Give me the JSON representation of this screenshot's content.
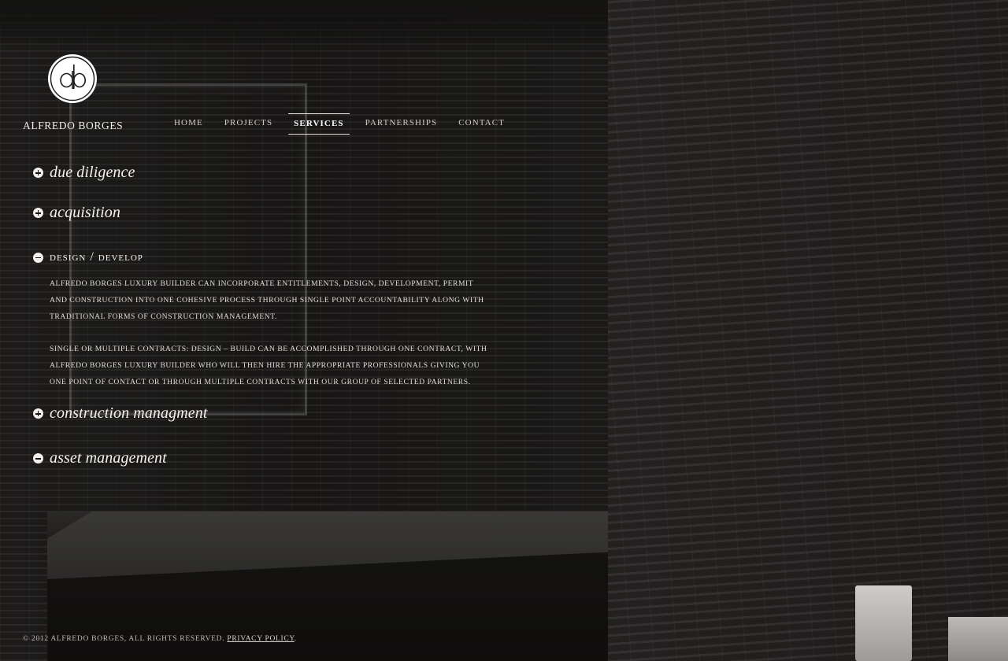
{
  "brand": {
    "name": "ALFREDO BORGES",
    "monogram": "ab"
  },
  "nav": {
    "items": [
      {
        "label": "HOME",
        "active": false
      },
      {
        "label": "PROJECTS",
        "active": false
      },
      {
        "label": "SERVICES",
        "active": true
      },
      {
        "label": "PARTNERSHIPS",
        "active": false
      },
      {
        "label": "CONTACT",
        "active": false
      }
    ]
  },
  "services": {
    "items": [
      {
        "title": "due diligence",
        "expanded": false,
        "icon": "plus-circle-icon"
      },
      {
        "title": "acquisition",
        "expanded": false,
        "icon": "plus-circle-icon"
      },
      {
        "title": "design / develop",
        "expanded": true,
        "icon": "minus-circle-icon",
        "paragraphs": [
          "Alfredo Borges Luxury Builder can incorporate entitlements, design, development, permit and construction into one cohesive process through single point accountability along with traditional forms of construction management.",
          "Single or multiple contracts: Design – Build can be accomplished through one contract, with Alfredo Borges Luxury Builder who will then hire the appropriate professionals giving you one point of contact or through multiple contracts with our group of selected partners."
        ]
      },
      {
        "title": "construction managment",
        "expanded": false,
        "icon": "plus-circle-icon"
      },
      {
        "title": "asset management",
        "expanded": false,
        "icon": "minus-circle-icon"
      }
    ]
  },
  "footer": {
    "copyright": "© 2012 Alfredo Borges, all rights reserved.",
    "privacy_label": "Privacy Policy",
    "suffix": "."
  },
  "colors": {
    "background": "#0e0d0c",
    "text": "#e9e6e2",
    "accent": "#ffffff"
  }
}
